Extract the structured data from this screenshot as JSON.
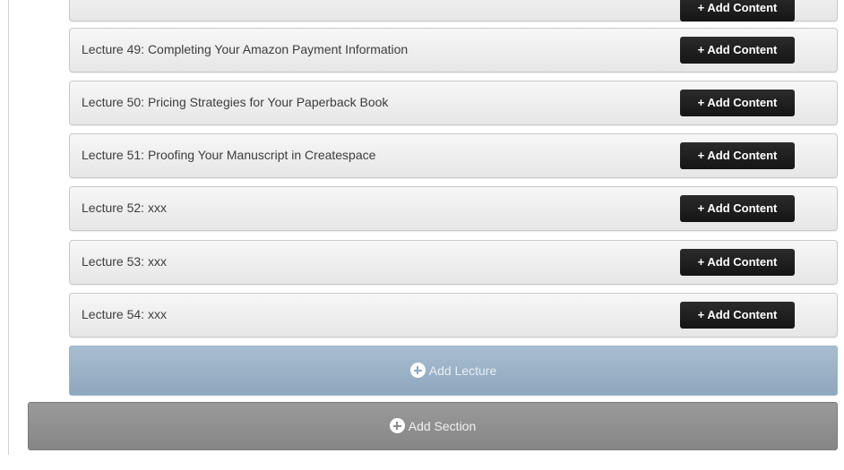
{
  "lectures": {
    "items": [
      {
        "title": "",
        "button_label": "+ Add Content"
      },
      {
        "title": "Lecture 49: Completing Your Amazon Payment Information",
        "button_label": "+ Add Content"
      },
      {
        "title": "Lecture 50: Pricing Strategies for Your Paperback Book",
        "button_label": "+ Add Content"
      },
      {
        "title": "Lecture 51: Proofing Your Manuscript in Createspace",
        "button_label": "+ Add Content"
      },
      {
        "title": "Lecture 52: xxx",
        "button_label": "+ Add Content"
      },
      {
        "title": "Lecture 53: xxx",
        "button_label": "+ Add Content"
      },
      {
        "title": "Lecture 54: xxx",
        "button_label": "+ Add Content"
      }
    ]
  },
  "actions": {
    "add_lecture_label": "Add Lecture",
    "add_section_label": "Add Section"
  },
  "icons": {
    "add": "plus-circle-icon"
  },
  "colors": {
    "add_lecture_bg": "#9fb4c8",
    "add_section_bg": "#8f8f8f",
    "button_bg": "#1c1c1c",
    "row_bg": "#eeeeee"
  }
}
